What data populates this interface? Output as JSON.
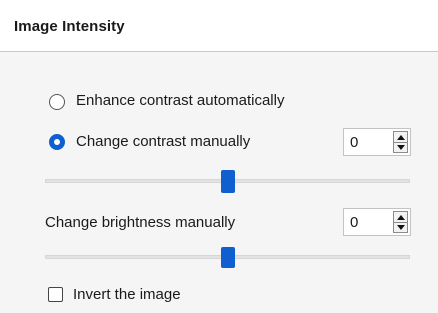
{
  "panel": {
    "title": "Image Intensity"
  },
  "enhance": {
    "label": "Enhance contrast automatically",
    "checked": false
  },
  "contrast": {
    "label": "Change contrast manually",
    "checked": true,
    "value": "0",
    "slider_level": 0.5
  },
  "brightness": {
    "label": "Change brightness manually",
    "value": "0",
    "slider_level": 0.5
  },
  "invert": {
    "label": "Invert the image",
    "checked": false
  },
  "colors": {
    "accent": "#0f5fd0",
    "panel_bg": "#f5f5f5",
    "header_bg": "#ffffff"
  },
  "icons": [
    "radio-unchecked-icon",
    "radio-checked-icon",
    "spin-up-icon",
    "spin-down-icon",
    "checkbox-icon"
  ]
}
